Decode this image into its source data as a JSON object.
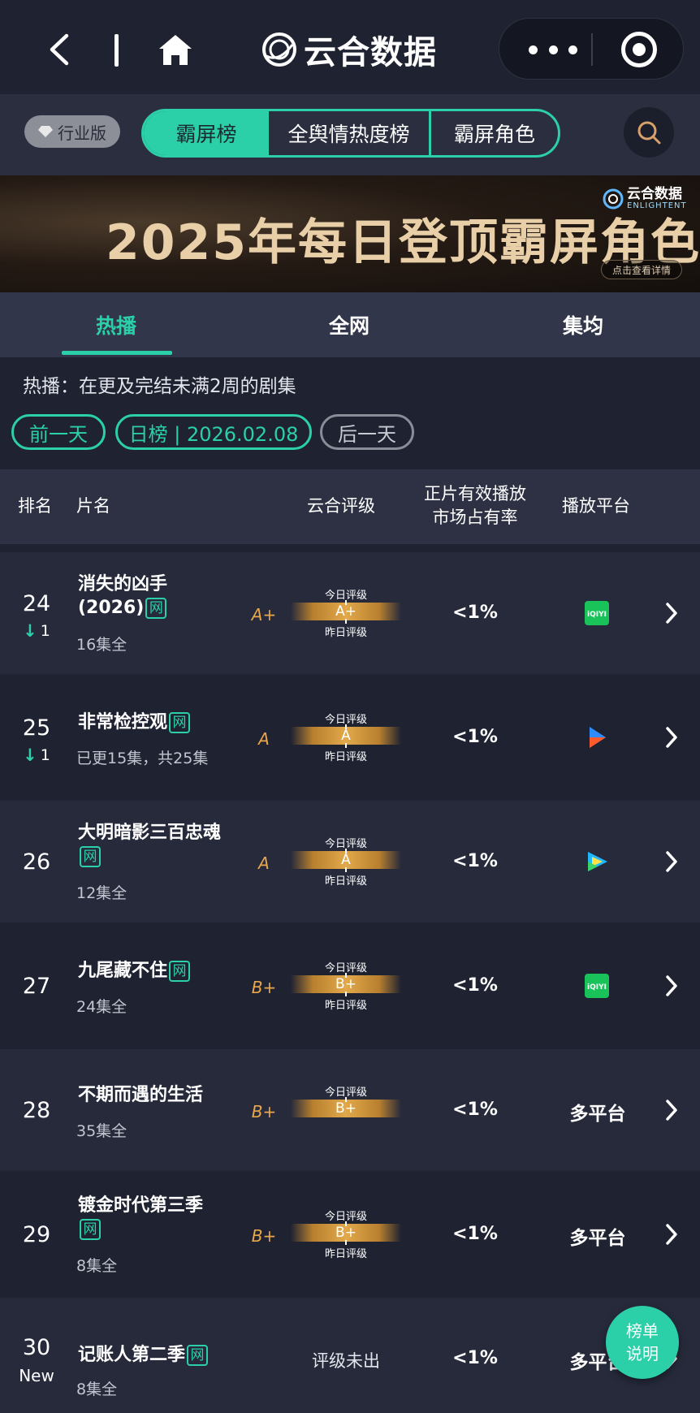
{
  "nav": {
    "brand": "云合数据"
  },
  "tabbar": {
    "edition": "行业版",
    "segments": [
      "霸屏榜",
      "全舆情热度榜",
      "霸屏角色"
    ]
  },
  "banner": {
    "title": "2025年每日登顶霸屏角色",
    "logo_text": "云合数据",
    "logo_sub": "ENLIGHTENT",
    "cta": "点击查看详情"
  },
  "subtabs": [
    "热播",
    "全网",
    "集均"
  ],
  "description": "热播：在更及完结未满2周的剧集",
  "date_controls": {
    "prev": "前一天",
    "current": "日榜 | 2026.02.08",
    "next": "后一天"
  },
  "table_header": {
    "rank": "排名",
    "name": "片名",
    "grade": "云合评级",
    "share_line1": "正片有效播放",
    "share_line2": "市场占有率",
    "platform": "播放平台"
  },
  "grade_labels": {
    "today": "今日评级",
    "yesterday": "昨日评级"
  },
  "wang_tag": "网",
  "rows": [
    {
      "rank": "24",
      "change": "1",
      "title": "消失的凶手(2026)",
      "wang": true,
      "eps": "16集全",
      "grade": "A+",
      "today_grade": "A+",
      "share": "<1%",
      "platform": "",
      "platform_icon": "iqiyi-icon"
    },
    {
      "rank": "25",
      "change": "1",
      "title": "非常检控观",
      "wang": true,
      "eps": "已更15集，共25集",
      "grade": "A",
      "today_grade": "A",
      "share": "<1%",
      "platform": "",
      "platform_icon": "youku-icon"
    },
    {
      "rank": "26",
      "change": "",
      "title": "大明暗影三百忠魂",
      "wang": true,
      "eps": "12集全",
      "grade": "A",
      "today_grade": "A",
      "share": "<1%",
      "platform": "",
      "platform_icon": "tencent-video-icon"
    },
    {
      "rank": "27",
      "change": "",
      "title": "九尾藏不住",
      "wang": true,
      "eps": "24集全",
      "grade": "B+",
      "today_grade": "B+",
      "share": "<1%",
      "platform": "",
      "platform_icon": "iqiyi-icon"
    },
    {
      "rank": "28",
      "change": "",
      "title": "不期而遇的生活",
      "wang": false,
      "eps": "35集全",
      "grade": "B+",
      "today_grade": "B+",
      "share": "<1%",
      "platform": "多平台",
      "platform_icon": ""
    },
    {
      "rank": "29",
      "change": "",
      "title": "镀金时代第三季",
      "wang": true,
      "eps": "8集全",
      "grade": "B+",
      "today_grade": "B+",
      "share": "<1%",
      "platform": "多平台",
      "platform_icon": ""
    },
    {
      "rank": "30",
      "rank_label": "New",
      "title": "记账人第二季",
      "wang": true,
      "eps": "8集全",
      "no_grade": "评级未出",
      "share": "<1%",
      "platform": "多平台",
      "platform_icon": ""
    }
  ],
  "help_button": {
    "line1": "榜单",
    "line2": "说明"
  },
  "colors": {
    "accent": "#2bd0a8",
    "grade": "#e9a64a",
    "background": "#1f2231"
  }
}
